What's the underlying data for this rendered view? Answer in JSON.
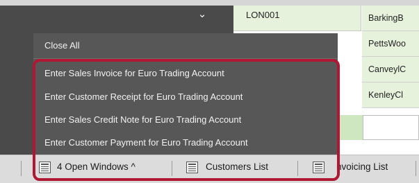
{
  "window_menu": {
    "dropdown_icon": "chevron-down-icon",
    "close_all": "Close All",
    "items": [
      "Enter Sales Invoice for Euro Trading Account",
      "Enter Customer Receipt for Euro Trading Account",
      "Enter Sales Credit Note for Euro Trading Account",
      "Enter Customer Payment for Euro Trading Account"
    ],
    "highlight_color": "#b01733"
  },
  "background_table": {
    "account_code": "LON001",
    "towns": [
      "BarkingB",
      "PettsWoo",
      "CanveylC",
      "KenleyCl"
    ]
  },
  "taskbar": {
    "open_windows_label": "4 Open Windows ^",
    "customers_list_label": "Customers List",
    "invoicing_list_label": "nvoicing List"
  }
}
